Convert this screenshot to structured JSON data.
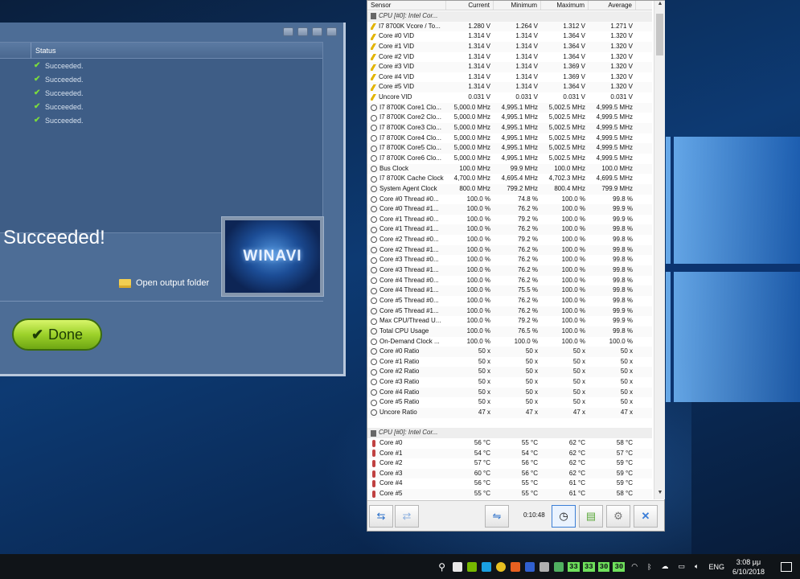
{
  "winavi": {
    "status_header": "Status",
    "status_items": [
      "Succeeded.",
      "Succeeded.",
      "Succeeded.",
      "Succeeded.",
      "Succeeded."
    ],
    "result_text": "Succeeded!",
    "logo_text": "WINAVI",
    "open_folder_label": "Open output folder",
    "done_label": "Done"
  },
  "hwinfo": {
    "columns": [
      "Sensor",
      "Current",
      "Minimum",
      "Maximum",
      "Average"
    ],
    "rows": [
      {
        "type": "group",
        "icon": "chip-icon",
        "name": "CPU [#0]: Intel Cor...",
        "cur": "",
        "min": "",
        "max": "",
        "avg": ""
      },
      {
        "icon": "voltage-icon",
        "name": "I7 8700K Vcore / To...",
        "cur": "1.280 V",
        "min": "1.264 V",
        "max": "1.312 V",
        "avg": "1.271 V"
      },
      {
        "icon": "voltage-icon",
        "name": "Core #0 VID",
        "cur": "1.314 V",
        "min": "1.314 V",
        "max": "1.364 V",
        "avg": "1.320 V"
      },
      {
        "icon": "voltage-icon",
        "name": "Core #1 VID",
        "cur": "1.314 V",
        "min": "1.314 V",
        "max": "1.364 V",
        "avg": "1.320 V"
      },
      {
        "icon": "voltage-icon",
        "name": "Core #2 VID",
        "cur": "1.314 V",
        "min": "1.314 V",
        "max": "1.364 V",
        "avg": "1.320 V"
      },
      {
        "icon": "voltage-icon",
        "name": "Core #3 VID",
        "cur": "1.314 V",
        "min": "1.314 V",
        "max": "1.369 V",
        "avg": "1.320 V"
      },
      {
        "icon": "voltage-icon",
        "name": "Core #4 VID",
        "cur": "1.314 V",
        "min": "1.314 V",
        "max": "1.369 V",
        "avg": "1.320 V"
      },
      {
        "icon": "voltage-icon",
        "name": "Core #5 VID",
        "cur": "1.314 V",
        "min": "1.314 V",
        "max": "1.364 V",
        "avg": "1.320 V"
      },
      {
        "icon": "voltage-icon",
        "name": "Uncore VID",
        "cur": "0.031 V",
        "min": "0.031 V",
        "max": "0.031 V",
        "avg": "0.031 V"
      },
      {
        "icon": "clock-icon",
        "name": "I7 8700K Core1 Clo...",
        "cur": "5,000.0 MHz",
        "min": "4,995.1 MHz",
        "max": "5,002.5 MHz",
        "avg": "4,999.5 MHz"
      },
      {
        "icon": "clock-icon",
        "name": "I7 8700K Core2 Clo...",
        "cur": "5,000.0 MHz",
        "min": "4,995.1 MHz",
        "max": "5,002.5 MHz",
        "avg": "4,999.5 MHz"
      },
      {
        "icon": "clock-icon",
        "name": "I7 8700K Core3 Clo...",
        "cur": "5,000.0 MHz",
        "min": "4,995.1 MHz",
        "max": "5,002.5 MHz",
        "avg": "4,999.5 MHz"
      },
      {
        "icon": "clock-icon",
        "name": "I7 8700K Core4 Clo...",
        "cur": "5,000.0 MHz",
        "min": "4,995.1 MHz",
        "max": "5,002.5 MHz",
        "avg": "4,999.5 MHz"
      },
      {
        "icon": "clock-icon",
        "name": "I7 8700K Core5 Clo...",
        "cur": "5,000.0 MHz",
        "min": "4,995.1 MHz",
        "max": "5,002.5 MHz",
        "avg": "4,999.5 MHz"
      },
      {
        "icon": "clock-icon",
        "name": "I7 8700K Core6 Clo...",
        "cur": "5,000.0 MHz",
        "min": "4,995.1 MHz",
        "max": "5,002.5 MHz",
        "avg": "4,999.5 MHz"
      },
      {
        "icon": "clock-icon",
        "name": "Bus Clock",
        "cur": "100.0 MHz",
        "min": "99.9 MHz",
        "max": "100.0 MHz",
        "avg": "100.0 MHz"
      },
      {
        "icon": "clock-icon",
        "name": "I7 8700K Cache Clock",
        "cur": "4,700.0 MHz",
        "min": "4,695.4 MHz",
        "max": "4,702.3 MHz",
        "avg": "4,699.5 MHz"
      },
      {
        "icon": "clock-icon",
        "name": "System Agent Clock",
        "cur": "800.0 MHz",
        "min": "799.2 MHz",
        "max": "800.4 MHz",
        "avg": "799.9 MHz"
      },
      {
        "icon": "clock-icon",
        "name": "Core #0 Thread #0...",
        "cur": "100.0 %",
        "min": "74.8 %",
        "max": "100.0 %",
        "avg": "99.8 %"
      },
      {
        "icon": "clock-icon",
        "name": "Core #0 Thread #1...",
        "cur": "100.0 %",
        "min": "76.2 %",
        "max": "100.0 %",
        "avg": "99.9 %"
      },
      {
        "icon": "clock-icon",
        "name": "Core #1 Thread #0...",
        "cur": "100.0 %",
        "min": "79.2 %",
        "max": "100.0 %",
        "avg": "99.9 %"
      },
      {
        "icon": "clock-icon",
        "name": "Core #1 Thread #1...",
        "cur": "100.0 %",
        "min": "76.2 %",
        "max": "100.0 %",
        "avg": "99.8 %"
      },
      {
        "icon": "clock-icon",
        "name": "Core #2 Thread #0...",
        "cur": "100.0 %",
        "min": "79.2 %",
        "max": "100.0 %",
        "avg": "99.8 %"
      },
      {
        "icon": "clock-icon",
        "name": "Core #2 Thread #1...",
        "cur": "100.0 %",
        "min": "76.2 %",
        "max": "100.0 %",
        "avg": "99.8 %"
      },
      {
        "icon": "clock-icon",
        "name": "Core #3 Thread #0...",
        "cur": "100.0 %",
        "min": "76.2 %",
        "max": "100.0 %",
        "avg": "99.8 %"
      },
      {
        "icon": "clock-icon",
        "name": "Core #3 Thread #1...",
        "cur": "100.0 %",
        "min": "76.2 %",
        "max": "100.0 %",
        "avg": "99.8 %"
      },
      {
        "icon": "clock-icon",
        "name": "Core #4 Thread #0...",
        "cur": "100.0 %",
        "min": "76.2 %",
        "max": "100.0 %",
        "avg": "99.8 %"
      },
      {
        "icon": "clock-icon",
        "name": "Core #4 Thread #1...",
        "cur": "100.0 %",
        "min": "75.5 %",
        "max": "100.0 %",
        "avg": "99.8 %"
      },
      {
        "icon": "clock-icon",
        "name": "Core #5 Thread #0...",
        "cur": "100.0 %",
        "min": "76.2 %",
        "max": "100.0 %",
        "avg": "99.8 %"
      },
      {
        "icon": "clock-icon",
        "name": "Core #5 Thread #1...",
        "cur": "100.0 %",
        "min": "76.2 %",
        "max": "100.0 %",
        "avg": "99.9 %"
      },
      {
        "icon": "clock-icon",
        "name": "Max CPU/Thread U...",
        "cur": "100.0 %",
        "min": "79.2 %",
        "max": "100.0 %",
        "avg": "99.9 %"
      },
      {
        "icon": "clock-icon",
        "name": "Total CPU Usage",
        "cur": "100.0 %",
        "min": "76.5 %",
        "max": "100.0 %",
        "avg": "99.8 %"
      },
      {
        "icon": "clock-icon",
        "name": "On-Demand Clock ...",
        "cur": "100.0 %",
        "min": "100.0 %",
        "max": "100.0 %",
        "avg": "100.0 %"
      },
      {
        "icon": "clock-icon",
        "name": "Core #0 Ratio",
        "cur": "50 x",
        "min": "50 x",
        "max": "50 x",
        "avg": "50 x"
      },
      {
        "icon": "clock-icon",
        "name": "Core #1 Ratio",
        "cur": "50 x",
        "min": "50 x",
        "max": "50 x",
        "avg": "50 x"
      },
      {
        "icon": "clock-icon",
        "name": "Core #2 Ratio",
        "cur": "50 x",
        "min": "50 x",
        "max": "50 x",
        "avg": "50 x"
      },
      {
        "icon": "clock-icon",
        "name": "Core #3 Ratio",
        "cur": "50 x",
        "min": "50 x",
        "max": "50 x",
        "avg": "50 x"
      },
      {
        "icon": "clock-icon",
        "name": "Core #4 Ratio",
        "cur": "50 x",
        "min": "50 x",
        "max": "50 x",
        "avg": "50 x"
      },
      {
        "icon": "clock-icon",
        "name": "Core #5 Ratio",
        "cur": "50 x",
        "min": "50 x",
        "max": "50 x",
        "avg": "50 x"
      },
      {
        "icon": "clock-icon",
        "name": "Uncore Ratio",
        "cur": "47 x",
        "min": "47 x",
        "max": "47 x",
        "avg": "47 x"
      },
      {
        "type": "blank",
        "name": "",
        "cur": "",
        "min": "",
        "max": "",
        "avg": ""
      },
      {
        "type": "group",
        "icon": "chip-icon",
        "name": "CPU [#0]: Intel Cor...",
        "cur": "",
        "min": "",
        "max": "",
        "avg": ""
      },
      {
        "icon": "thermometer-icon",
        "name": "Core #0",
        "cur": "56 °C",
        "min": "55 °C",
        "max": "62 °C",
        "avg": "58 °C"
      },
      {
        "icon": "thermometer-icon",
        "name": "Core #1",
        "cur": "54 °C",
        "min": "54 °C",
        "max": "62 °C",
        "avg": "57 °C"
      },
      {
        "icon": "thermometer-icon",
        "name": "Core #2",
        "cur": "57 °C",
        "min": "56 °C",
        "max": "62 °C",
        "avg": "59 °C"
      },
      {
        "icon": "thermometer-icon",
        "name": "Core #3",
        "cur": "60 °C",
        "min": "56 °C",
        "max": "62 °C",
        "avg": "59 °C"
      },
      {
        "icon": "thermometer-icon",
        "name": "Core #4",
        "cur": "56 °C",
        "min": "55 °C",
        "max": "61 °C",
        "avg": "59 °C"
      },
      {
        "icon": "thermometer-icon",
        "name": "Core #5",
        "cur": "55 °C",
        "min": "55 °C",
        "max": "61 °C",
        "avg": "58 °C"
      }
    ],
    "timer": "0:10:48"
  },
  "taskbar": {
    "tray_numbers": [
      "33",
      "33",
      "30",
      "30"
    ],
    "language": "ENG",
    "time": "3:08 μμ",
    "date": "6/10/2018"
  }
}
